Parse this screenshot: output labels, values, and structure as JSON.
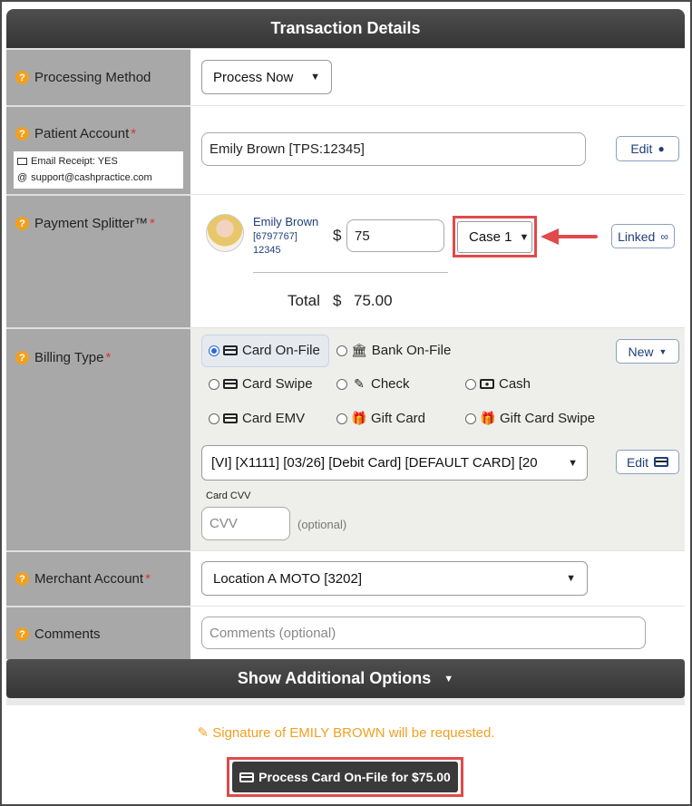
{
  "header": {
    "title": "Transaction Details"
  },
  "processing_method": {
    "label": "Processing Method",
    "value": "Process Now"
  },
  "patient_account": {
    "label": "Patient Account",
    "value": "Emily Brown [TPS:12345]",
    "email_receipt": "Email Receipt: YES",
    "email": "support@cashpractice.com",
    "edit_label": "Edit"
  },
  "payment_splitter": {
    "label": "Payment Splitter™",
    "patient_name": "Emily Brown",
    "patient_id": "[6797767]",
    "patient_code": "12345",
    "currency": "$",
    "amount": "75",
    "case_value": "Case 1",
    "linked_label": "Linked",
    "total_label": "Total",
    "total_currency": "$",
    "total_value": "75.00"
  },
  "billing_type": {
    "label": "Billing Type",
    "new_label": "New",
    "options": [
      {
        "label": "Card On-File",
        "selected": true
      },
      {
        "label": "Bank On-File",
        "selected": false
      },
      {
        "label": "Card Swipe",
        "selected": false
      },
      {
        "label": "Check",
        "selected": false
      },
      {
        "label": "Cash",
        "selected": false
      },
      {
        "label": "Card EMV",
        "selected": false
      },
      {
        "label": "Gift Card",
        "selected": false
      },
      {
        "label": "Gift Card Swipe",
        "selected": false
      }
    ],
    "card_value": "[VI] [X1111] [03/26] [Debit Card] [DEFAULT CARD] [20",
    "edit_label": "Edit",
    "cvv_label": "Card CVV",
    "cvv_placeholder": "CVV",
    "cvv_hint": "(optional)"
  },
  "merchant_account": {
    "label": "Merchant Account",
    "value": "Location A MOTO [3202]"
  },
  "comments": {
    "label": "Comments",
    "placeholder": "Comments (optional)"
  },
  "additional_options": {
    "label": "Show Additional Options"
  },
  "signature_notice": "Signature of EMILY BROWN will be requested.",
  "process_button": "Process Card On-File for $75.00",
  "colors": {
    "accent_orange": "#f0a020",
    "highlight_red": "#e04a4a",
    "header_dark": "#3a3a3a"
  }
}
